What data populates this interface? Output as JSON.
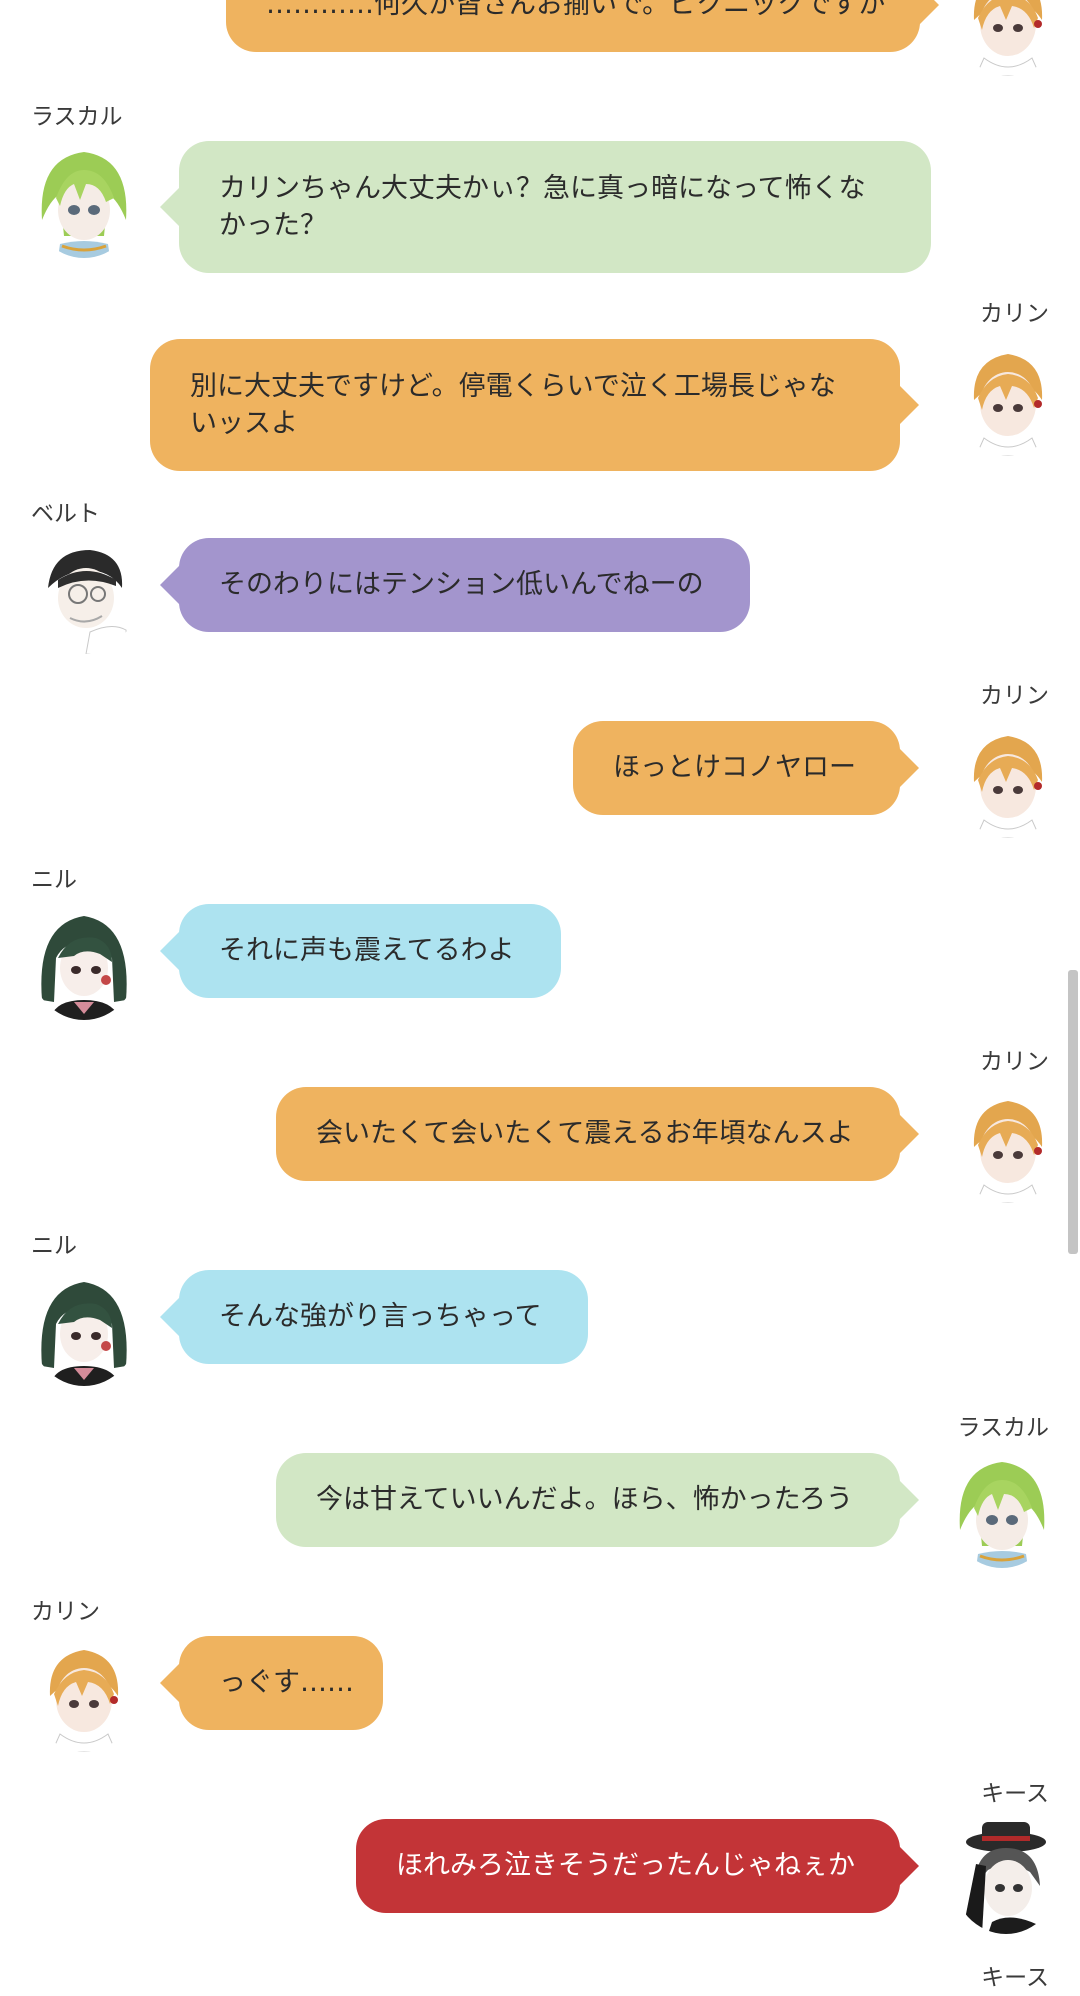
{
  "messages": [
    {
      "speaker": "",
      "text": "…………何久か皆さんお揃いで。ピクニックですか",
      "side": "right",
      "color": "orange",
      "avatar": "karin-avatar"
    },
    {
      "speaker": "ラスカル",
      "text": "カリンちゃん大丈夫かぃ？急に真っ暗になって怖くなかった？",
      "side": "left",
      "color": "green",
      "avatar": "rascal-avatar"
    },
    {
      "speaker": "カリン",
      "text": "別に大丈夫ですけど。停電くらいで泣く工場長じゃないッスよ",
      "side": "right",
      "color": "orange",
      "avatar": "karin-avatar"
    },
    {
      "speaker": "ベルト",
      "text": "そのわりにはテンション低いんでねーの",
      "side": "left",
      "color": "purple",
      "avatar": "belt-avatar"
    },
    {
      "speaker": "カリン",
      "text": "ほっとけコノヤロー",
      "side": "right",
      "color": "orange",
      "avatar": "karin-avatar"
    },
    {
      "speaker": "ニル",
      "text": "それに声も震えてるわよ",
      "side": "left",
      "color": "cyan",
      "avatar": "nil-avatar"
    },
    {
      "speaker": "カリン",
      "text": "会いたくて会いたくて震えるお年頃なんスよ",
      "side": "right",
      "color": "orange",
      "avatar": "karin-avatar"
    },
    {
      "speaker": "ニル",
      "text": "そんな強がり言っちゃって",
      "side": "left",
      "color": "cyan",
      "avatar": "nil-avatar"
    },
    {
      "speaker": "ラスカル",
      "text": "今は甘えていいんだよ。ほら、怖かったろう",
      "side": "right",
      "color": "green",
      "avatar": "rascal-avatar"
    },
    {
      "speaker": "カリン",
      "text": "っぐす……",
      "side": "left",
      "color": "orange",
      "avatar": "karin-avatar"
    },
    {
      "speaker": "キース",
      "text": "ほれみろ泣きそうだったんじゃねぇか",
      "side": "right",
      "color": "red",
      "avatar": "keith-avatar"
    },
    {
      "speaker": "キース",
      "text": "",
      "side": "right",
      "color": "",
      "avatar": ""
    }
  ],
  "colors": {
    "orange": "#efb35f",
    "green": "#d2e7c5",
    "purple": "#a395cd",
    "cyan": "#ade3f0",
    "red": "#c33437"
  }
}
